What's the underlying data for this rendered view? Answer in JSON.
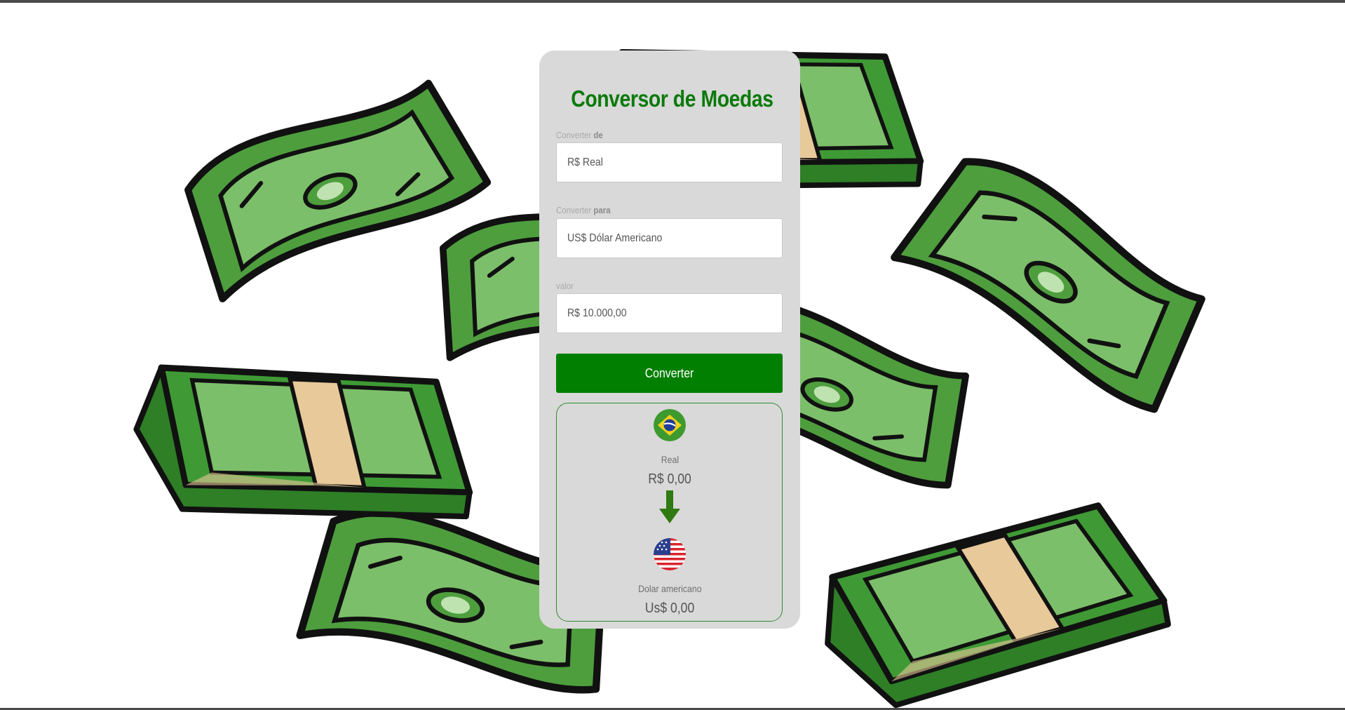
{
  "app": {
    "title": "Conversor de Moedas"
  },
  "form": {
    "from": {
      "label_prefix": "Converter",
      "label_strong": "de",
      "value": "R$ Real"
    },
    "to": {
      "label_prefix": "Converter",
      "label_strong": "para",
      "value": "US$ Dólar Americano"
    },
    "amount": {
      "label": "valor",
      "value": "R$ 10.000,00"
    },
    "submit_label": "Converter"
  },
  "result": {
    "source": {
      "flag_icon": "brazil-flag-icon",
      "name": "Real",
      "amount": "R$ 0,00"
    },
    "arrow_icon": "arrow-down-icon",
    "target": {
      "flag_icon": "usa-flag-icon",
      "name": "Dolar americano",
      "amount": "Us$ 0,00"
    }
  },
  "colors": {
    "accent": "#007f00",
    "title": "#0a7a0a",
    "card_bg": "#d9d9d9",
    "money_dark": "#3f9a35",
    "money_light": "#7cbf6a",
    "money_band": "#e8c99a"
  }
}
